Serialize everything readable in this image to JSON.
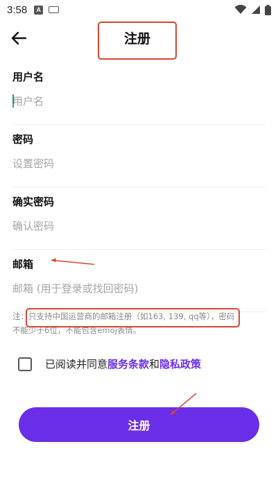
{
  "status_bar": {
    "time": "3:58",
    "a_badge": "A"
  },
  "header": {
    "title": "注册",
    "back_icon": "arrow-left-icon"
  },
  "form": {
    "username": {
      "label": "用户名",
      "placeholder": "用户名"
    },
    "password": {
      "label": "密码",
      "placeholder": "设置密码"
    },
    "confirm": {
      "label": "确实密码",
      "placeholder": "确认密码"
    },
    "email": {
      "label": "邮箱",
      "placeholder": "邮箱 (用于登录或找回密码)"
    }
  },
  "note": {
    "line1": "注：只支持中国运营商的邮箱注册（如163, 139, qq等），密码",
    "line2": "不能少于6位，不能包含emoj表情。"
  },
  "agreement": {
    "prefix": "已阅读并同意",
    "terms": "服务条款",
    "and": "和",
    "privacy": "隐私政策"
  },
  "register_button": "注册",
  "colors": {
    "accent": "#6a2ee8",
    "annotation": "#d9452f",
    "caret": "#1a9b7e"
  }
}
